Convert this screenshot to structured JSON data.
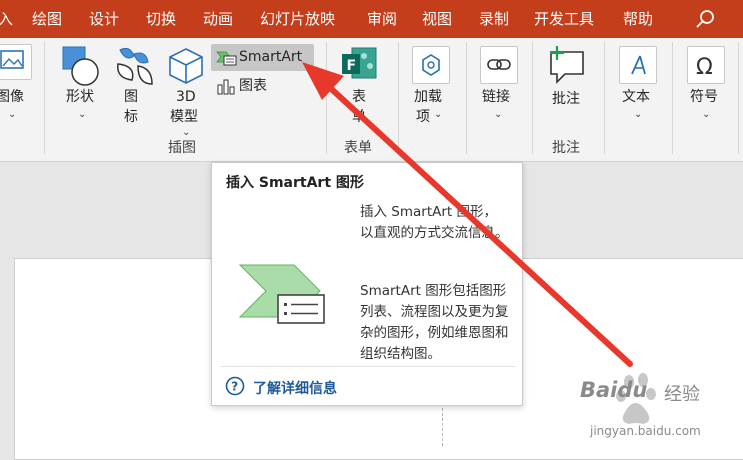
{
  "tabs": {
    "partial": "入",
    "items": [
      "绘图",
      "设计",
      "切换",
      "动画",
      "幻灯片放映",
      "审阅",
      "视图",
      "录制",
      "开发工具",
      "帮助"
    ],
    "search_icon": "search-icon"
  },
  "ribbon": {
    "image": {
      "label": "图像",
      "caret": "⌄"
    },
    "shapes": {
      "label": "形状",
      "caret": "⌄"
    },
    "icons": {
      "label_1": "图",
      "label_2": "标"
    },
    "model3d": {
      "label_1": "3D",
      "label_2": "模型",
      "caret": "⌄"
    },
    "smartart": {
      "label": "SmartArt"
    },
    "chart": {
      "label": "图表"
    },
    "group_insert_figure": "插图",
    "forms": {
      "label_1": "表",
      "label_2": "单"
    },
    "group_forms": "表单",
    "addins": {
      "label_1": "加载",
      "label_2": "项",
      "caret": "⌄"
    },
    "link": {
      "label": "链接",
      "caret": "⌄"
    },
    "comment": {
      "label": "批注"
    },
    "group_comments": "批注",
    "text": {
      "label": "文本",
      "caret": "⌄"
    },
    "symbol": {
      "label": "符号",
      "caret": "⌄"
    }
  },
  "tooltip": {
    "title": "插入 SmartArt 图形",
    "desc_1": "插入 SmartArt 图形，以直观的方式交流信息。",
    "desc_2": "SmartArt 图形包括图形列表、流程图以及更为复杂的图形，例如维恩图和组织结构图。",
    "help_link": "了解详细信息"
  },
  "watermark": {
    "brand": "Baidu",
    "jingyan": "经验",
    "url": "jingyan.baidu.com"
  },
  "colors": {
    "tab_bar": "#c43e1c",
    "ribbon": "#f3f3f3",
    "accent_blue": "#1e5b99",
    "arrow_red": "#e8382c",
    "smartart_green": "#5fb55f"
  }
}
